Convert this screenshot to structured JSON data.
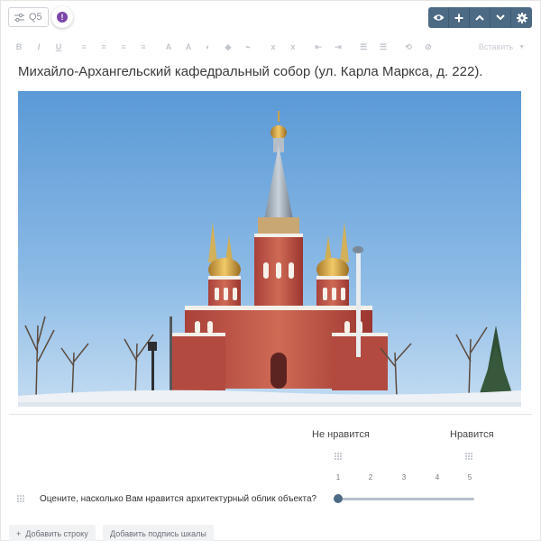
{
  "question_tag": {
    "label": "Q5"
  },
  "toolbar_actions": [
    "eye-icon",
    "plus-icon",
    "chevron-up-icon",
    "chevron-down-icon",
    "gear-icon"
  ],
  "format_toolbar": {
    "buttons": [
      "B",
      "I",
      "U",
      "≡",
      "≡",
      "≡",
      "≡",
      "A",
      "A",
      "◐",
      "◆",
      "⌁",
      "x",
      "x",
      "⇤",
      "⇥",
      "☰",
      "☰",
      "⟲",
      "⊘"
    ],
    "insert_label": "Вставить"
  },
  "question": {
    "title": "Михайло-Архангельский кафедральный собор (ул. Карла Маркса, д. 222).",
    "image_alt": "cathedral-photo"
  },
  "scale": {
    "left_label": "Не нравится",
    "right_label": "Нравится",
    "points": [
      "1",
      "2",
      "3",
      "4",
      "5"
    ],
    "rows": [
      {
        "label": "Оцените, насколько Вам нравится архитектурный облик объекта?",
        "value": 1
      }
    ]
  },
  "buttons": {
    "add_row": "Добавить строку",
    "add_scale_label": "Добавить подпись шкалы"
  },
  "colors": {
    "accent": "#4d6a85",
    "alert": "#7b46a8"
  }
}
